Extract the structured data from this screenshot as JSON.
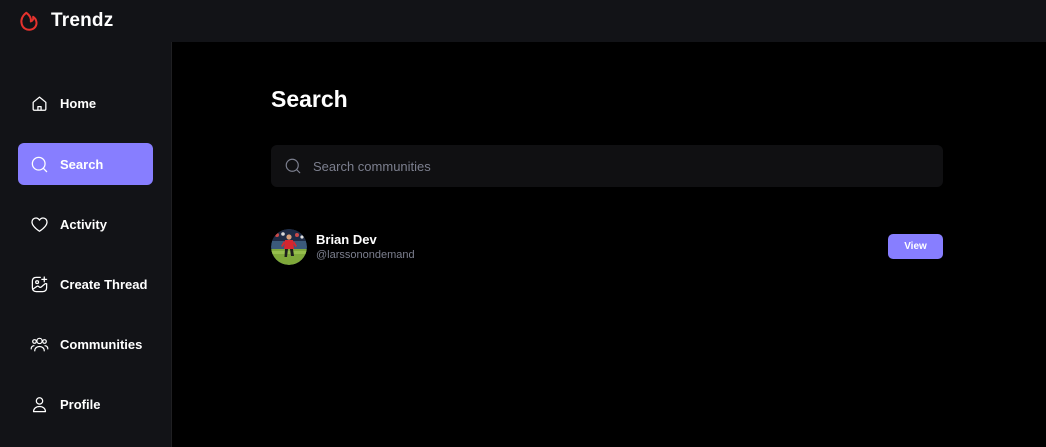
{
  "app": {
    "name": "Trendz",
    "brand_color": "#877eff",
    "logo_color": "#e5322d"
  },
  "sidebar": {
    "items": [
      {
        "label": "Home",
        "icon": "home-icon",
        "active": false
      },
      {
        "label": "Search",
        "icon": "search-icon",
        "active": true
      },
      {
        "label": "Activity",
        "icon": "heart-icon",
        "active": false
      },
      {
        "label": "Create Thread",
        "icon": "gallery-add-icon",
        "active": false
      },
      {
        "label": "Communities",
        "icon": "users-icon",
        "active": false
      },
      {
        "label": "Profile",
        "icon": "user-icon",
        "active": false
      }
    ]
  },
  "main": {
    "title": "Search",
    "search": {
      "placeholder": "Search communities",
      "value": ""
    },
    "results": [
      {
        "name": "Brian Dev",
        "handle": "@larssonondemand",
        "action_label": "View"
      }
    ]
  }
}
